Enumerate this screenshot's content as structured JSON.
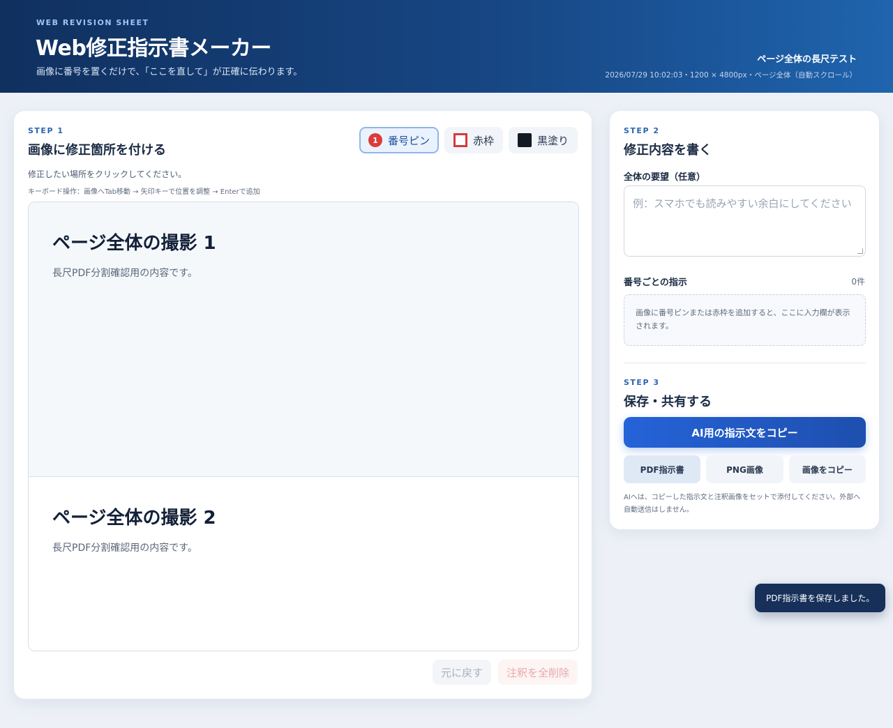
{
  "header": {
    "eyebrow": "WEB REVISION SHEET",
    "title": "Web修正指示書メーカー",
    "tagline": "画像に番号を置くだけで、「ここを直して」が正確に伝わります。",
    "meta_title": "ページ全体の長尺テスト",
    "meta_info": "2026/07/29 10:02:03・1200 × 4800px・ページ全体（自動スクロール）"
  },
  "step1": {
    "label": "STEP 1",
    "title": "画像に修正箇所を付ける",
    "tools": [
      {
        "label": "番号ピン",
        "badge": "1"
      },
      {
        "label": "赤枠"
      },
      {
        "label": "黒塗り"
      }
    ],
    "hint": "修正したい場所をクリックしてください。",
    "kbd_hint": "キーボード操作：画像へTab移動 → 矢印キーで位置を調整 → Enterで追加",
    "shots": [
      {
        "heading": "ページ全体の撮影 1",
        "text": "長尺PDF分割確認用の内容です。"
      },
      {
        "heading": "ページ全体の撮影 2",
        "text": "長尺PDF分割確認用の内容です。"
      }
    ],
    "undo_label": "元に戻す",
    "clear_label": "注釈を全削除"
  },
  "step2": {
    "label": "STEP 2",
    "title": "修正内容を書く",
    "overall_label": "全体の要望（任意）",
    "overall_placeholder": "例：スマホでも読みやすい余白にしてください",
    "per_pin_label": "番号ごとの指示",
    "count": "0件",
    "empty_text": "画像に番号ピンまたは赤枠を追加すると、ここに入力欄が表示されます。"
  },
  "step3": {
    "label": "STEP 3",
    "title": "保存・共有する",
    "copy_ai_label": "AI用の指示文をコピー",
    "pdf_label": "PDF指示書",
    "png_label": "PNG画像",
    "copy_img_label": "画像をコピー",
    "note": "AIへは、コピーした指示文と注釈画像をセットで添付してください。外部へ自動送信はしません。"
  },
  "toast": {
    "text": "PDF指示書を保存しました。"
  }
}
